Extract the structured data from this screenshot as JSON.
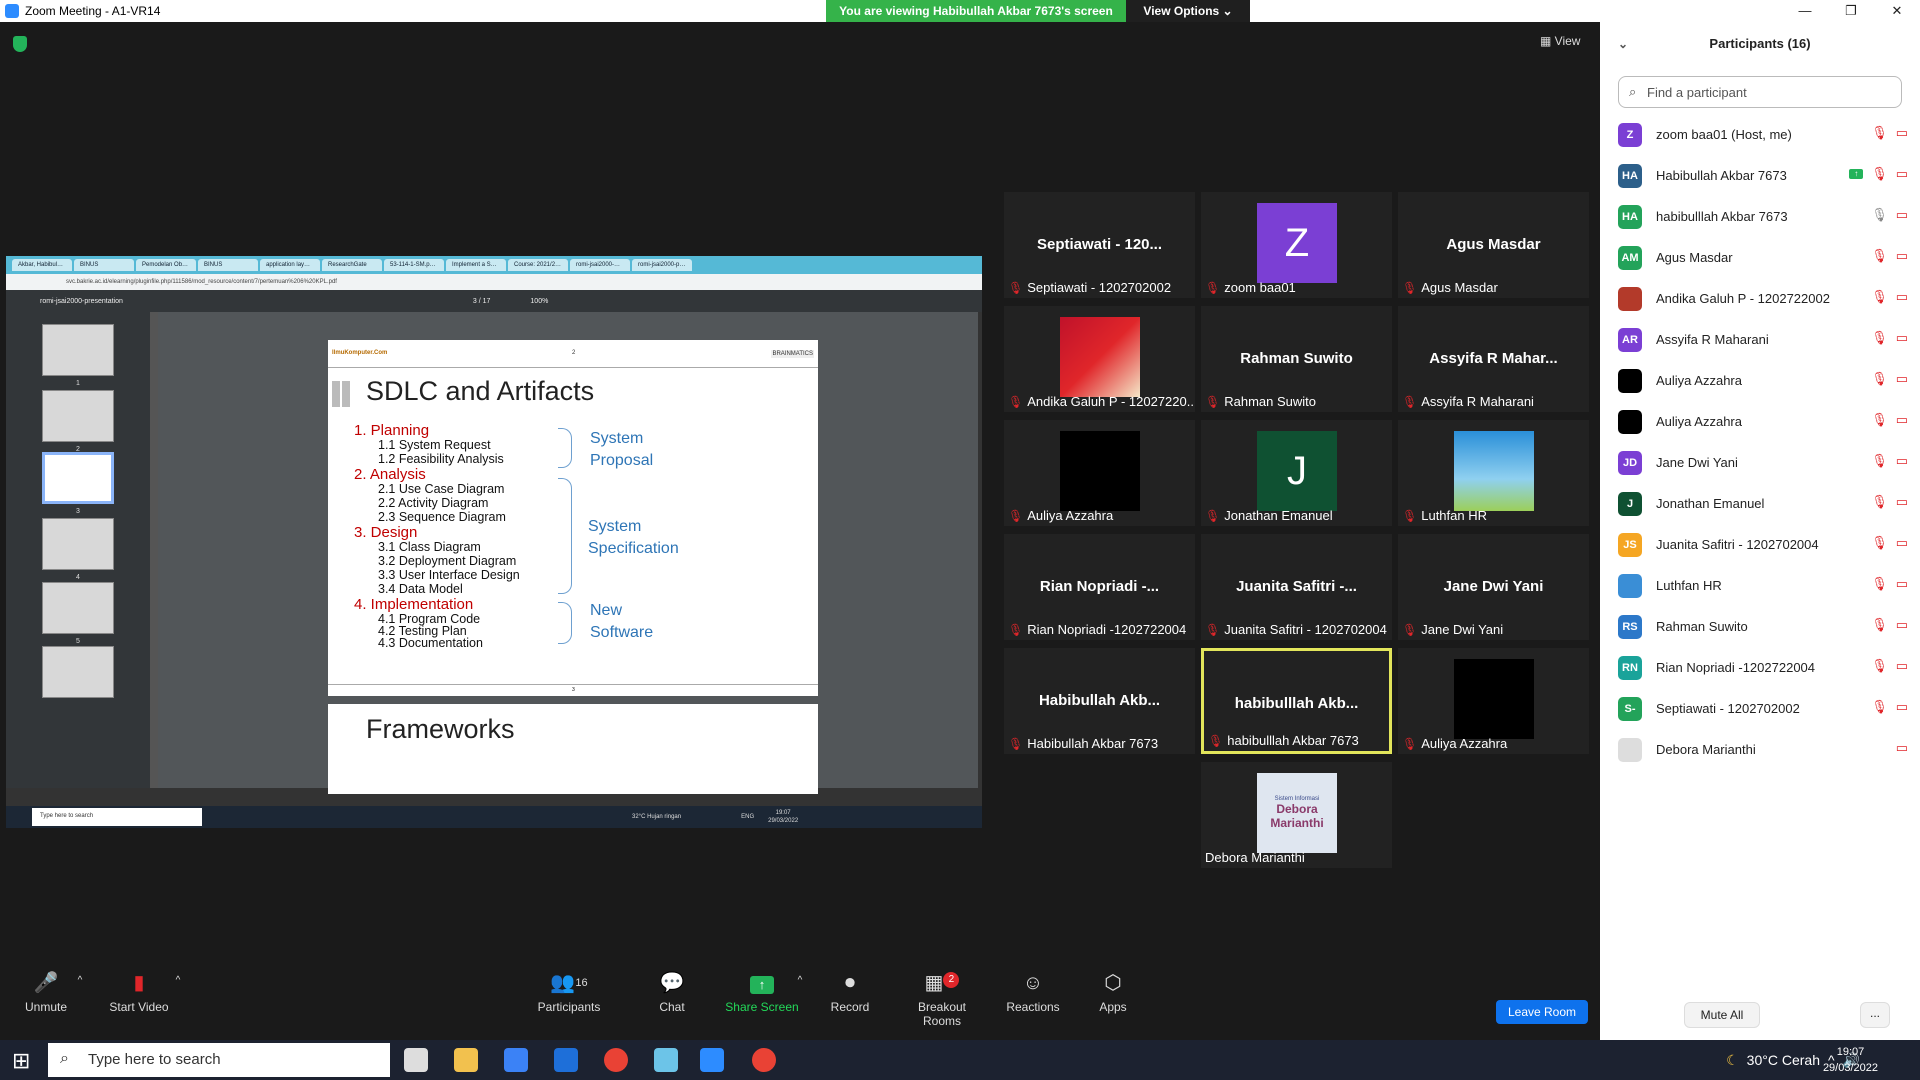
{
  "window": {
    "title": "Zoom Meeting - A1-VR14",
    "banner": "You are viewing Habibullah Akbar 7673's screen",
    "view_options": "View Options ⌄",
    "view_button": "View"
  },
  "shared_screen": {
    "browser_tabs": [
      "Akbar, Habibul…",
      "BINUS",
      "Pemodelan Ob…",
      "BINUS",
      "application lay…",
      "ResearchGate",
      "53-114-1-SM.p…",
      "Implement a S…",
      "Course: 2021/2…",
      "romi-jsai2000-…",
      "romi-jsai2000-p…"
    ],
    "url": "svc.bakrie.ac.id/elearning/pluginfile.php/111586/mod_resource/content/7/pertemuan%206%20KPL.pdf",
    "pdf_title": "romi-jsai2000-presentation",
    "page_indicator": "3 / 17",
    "zoom": "100%",
    "thumbnail_numbers": [
      "1",
      "2",
      "3",
      "4",
      "5"
    ],
    "slide": {
      "header_left": "IlmuKomputer.Com",
      "header_center": "2",
      "header_right": "BRAINMATICS",
      "title": "SDLC and Artifacts",
      "footer_center": "3",
      "sections": [
        {
          "label": "1.   Planning",
          "items": [
            "1.1 System Request",
            "1.2 Feasibility Analysis"
          ]
        },
        {
          "label": "2.   Analysis",
          "items": [
            "2.1 Use Case Diagram",
            "2.2 Activity Diagram",
            "2.3 Sequence Diagram"
          ]
        },
        {
          "label": "3.   Design",
          "items": [
            "3.1 Class Diagram",
            "3.2 Deployment Diagram",
            "3.3 User Interface Design",
            "3.4 Data Model"
          ]
        },
        {
          "label": "4.   Implementation",
          "items": [
            "4.1 Program Code",
            "4.2 Testing Plan",
            "4.3 Documentation"
          ]
        }
      ],
      "groups": [
        "System Proposal",
        "System Specification",
        "New Software"
      ],
      "next_title": "Frameworks"
    },
    "inner_taskbar_search": "Type here to search",
    "inner_taskbar_weather": "32°C  Hujan ringan",
    "inner_taskbar_lang": "ENG",
    "inner_taskbar_time": "19:07",
    "inner_taskbar_date": "29/03/2022"
  },
  "tiles": [
    {
      "big": "Septiawati - 120...",
      "label": "Septiawati - 1202702002"
    },
    {
      "avatar": "Z",
      "avatar_color": "#7b3fd4",
      "label": "zoom baa01"
    },
    {
      "big": "Agus Masdar",
      "label": "Agus Masdar"
    },
    {
      "photo": "red",
      "label": "Andika Galuh P - 12027220..."
    },
    {
      "big": "Rahman Suwito",
      "label": "Rahman Suwito"
    },
    {
      "big": "Assyifa R Mahar...",
      "label": "Assyifa R Maharani"
    },
    {
      "photo": "black",
      "label": "Auliya Azzahra"
    },
    {
      "avatar": "J",
      "avatar_color": "#0f5132",
      "label": "Jonathan Emanuel"
    },
    {
      "photo": "sky",
      "label": "Luthfan HR"
    },
    {
      "big": "Rian Nopriadi -...",
      "label": "Rian Nopriadi -1202722004"
    },
    {
      "big": "Juanita Safitri -...",
      "label": "Juanita Safitri - 1202702004"
    },
    {
      "big": "Jane Dwi Yani",
      "label": "Jane Dwi Yani"
    },
    {
      "big": "Habibullah Akb...",
      "label": "Habibullah Akbar 7673"
    },
    {
      "big": "habibulllah Akb...",
      "label": "habibulllah Akbar 7673"
    },
    {
      "photo": "black",
      "label": "Auliya Azzahra"
    },
    {
      "photo": "poster",
      "poster_top": "Sistem Informasi",
      "poster_main": "Debora Marianthi",
      "label": "Debora Marianthi"
    }
  ],
  "toolbar": {
    "unmute": "Unmute",
    "start_video": "Start Video",
    "participants": "Participants",
    "participants_count": "16",
    "chat": "Chat",
    "share_screen": "Share Screen",
    "record": "Record",
    "breakout_rooms": "Breakout Rooms",
    "breakout_badge": "2",
    "reactions": "Reactions",
    "apps": "Apps",
    "leave_room": "Leave Room"
  },
  "panel": {
    "title": "Participants (16)",
    "search_placeholder": "Find a participant",
    "mute_all": "Mute All",
    "more": "...",
    "participants": [
      {
        "initials": "Z",
        "color": "#7b3fd4",
        "name": "zoom baa01 (Host, me)"
      },
      {
        "initials": "HA",
        "color": "#2c5f8a",
        "name": "Habibullah Akbar 7673",
        "sharing": true
      },
      {
        "initials": "HA",
        "color": "#23a35a",
        "name": "habibulllah Akbar 7673",
        "mic_on": true
      },
      {
        "initials": "AM",
        "color": "#23a35a",
        "name": "Agus Masdar"
      },
      {
        "initials": "",
        "color": "#b33a2a",
        "name": "Andika Galuh P - 1202722002"
      },
      {
        "initials": "AR",
        "color": "#7b3fd4",
        "name": "Assyifa R Maharani"
      },
      {
        "initials": "",
        "color": "#000000",
        "name": "Auliya Azzahra"
      },
      {
        "initials": "",
        "color": "#000000",
        "name": "Auliya Azzahra"
      },
      {
        "initials": "JD",
        "color": "#7b3fd4",
        "name": "Jane Dwi Yani"
      },
      {
        "initials": "J",
        "color": "#0f5132",
        "name": "Jonathan Emanuel"
      },
      {
        "initials": "JS",
        "color": "#f5a623",
        "name": "Juanita Safitri - 1202702004"
      },
      {
        "initials": "",
        "color": "#3a8ed6",
        "name": "Luthfan HR"
      },
      {
        "initials": "RS",
        "color": "#2c78c9",
        "name": "Rahman Suwito"
      },
      {
        "initials": "RN",
        "color": "#1aa39a",
        "name": "Rian Nopriadi -1202722004"
      },
      {
        "initials": "S-",
        "color": "#23a35a",
        "name": "Septiawati - 1202702002"
      },
      {
        "initials": "",
        "color": "#dddddd",
        "name": "Debora Marianthi",
        "video_only": true
      }
    ]
  },
  "taskbar": {
    "search": "Type here to search",
    "weather": "30°C  Cerah",
    "time": "19:07",
    "date": "29/03/2022"
  }
}
